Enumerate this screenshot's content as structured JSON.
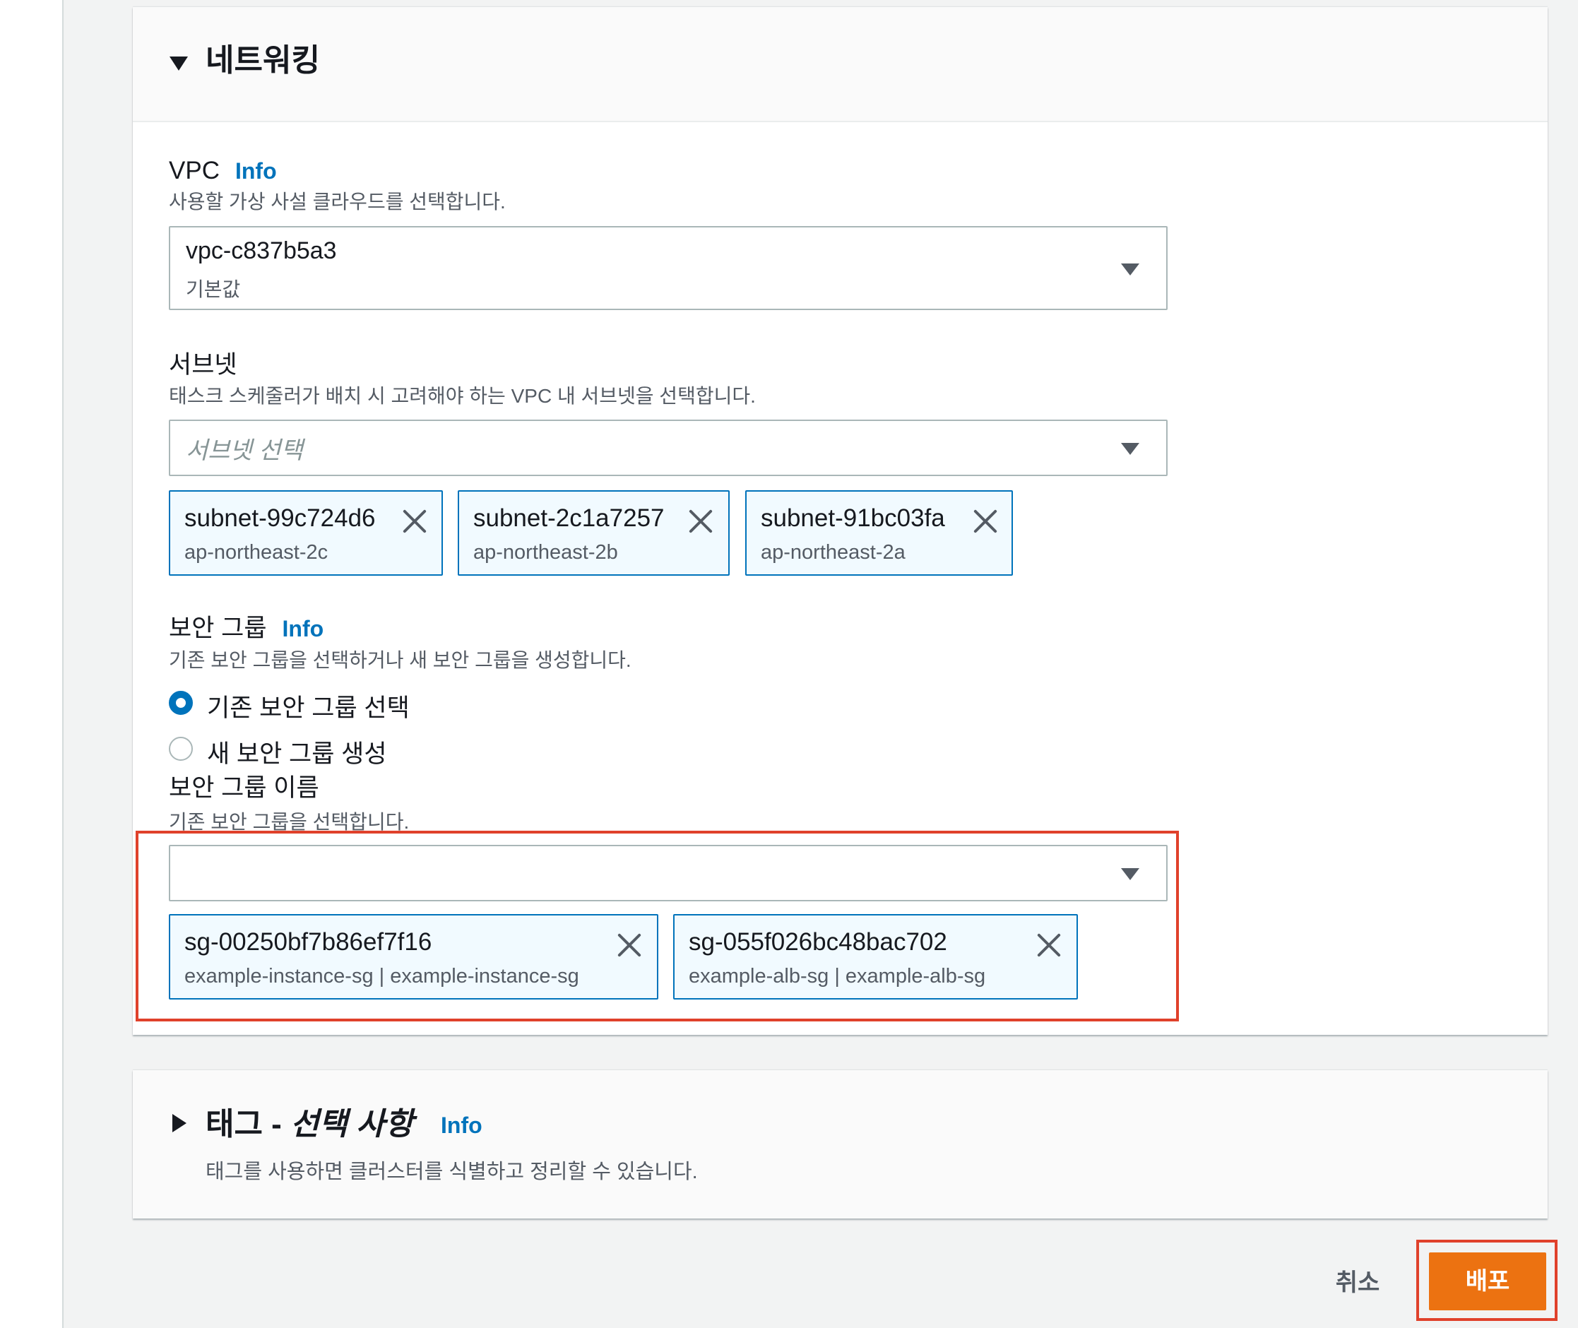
{
  "networking": {
    "title": "네트워킹",
    "vpc": {
      "label": "VPC",
      "info": "Info",
      "description": "사용할 가상 사설 클라우드를 선택합니다.",
      "selected_value": "vpc-c837b5a3",
      "selected_sub": "기본값"
    },
    "subnets": {
      "label": "서브넷",
      "description": "태스크 스케줄러가 배치 시 고려해야 하는 VPC 내 서브넷을 선택합니다.",
      "placeholder": "서브넷 선택",
      "tokens": [
        {
          "id": "subnet-99c724d6",
          "zone": "ap-northeast-2c"
        },
        {
          "id": "subnet-2c1a7257",
          "zone": "ap-northeast-2b"
        },
        {
          "id": "subnet-91bc03fa",
          "zone": "ap-northeast-2a"
        }
      ]
    },
    "security_group": {
      "label": "보안 그룹",
      "info": "Info",
      "description": "기존 보안 그룹을 선택하거나 새 보안 그룹을 생성합니다.",
      "options": [
        {
          "label": "기존 보안 그룹 선택",
          "selected": true
        },
        {
          "label": "새 보안 그룹 생성",
          "selected": false
        }
      ],
      "name_label": "보안 그룹 이름",
      "name_description": "기존 보안 그룹을 선택합니다.",
      "select_value": "",
      "tokens": [
        {
          "id": "sg-00250bf7b86ef7f16",
          "name": "example-instance-sg | example-instance-sg"
        },
        {
          "id": "sg-055f026bc48bac702",
          "name": "example-alb-sg | example-alb-sg"
        }
      ]
    }
  },
  "tags": {
    "title_main": "태그 - ",
    "title_optional": "선택 사항",
    "info": "Info",
    "description": "태그를 사용하면 클러스터를 식별하고 정리할 수 있습니다."
  },
  "footer": {
    "cancel_label": "취소",
    "deploy_label": "배포"
  },
  "colors": {
    "accent_link": "#0073bb",
    "primary_button": "#ec7211",
    "highlight_box": "#e0412b",
    "token_bg": "#f1faff"
  }
}
